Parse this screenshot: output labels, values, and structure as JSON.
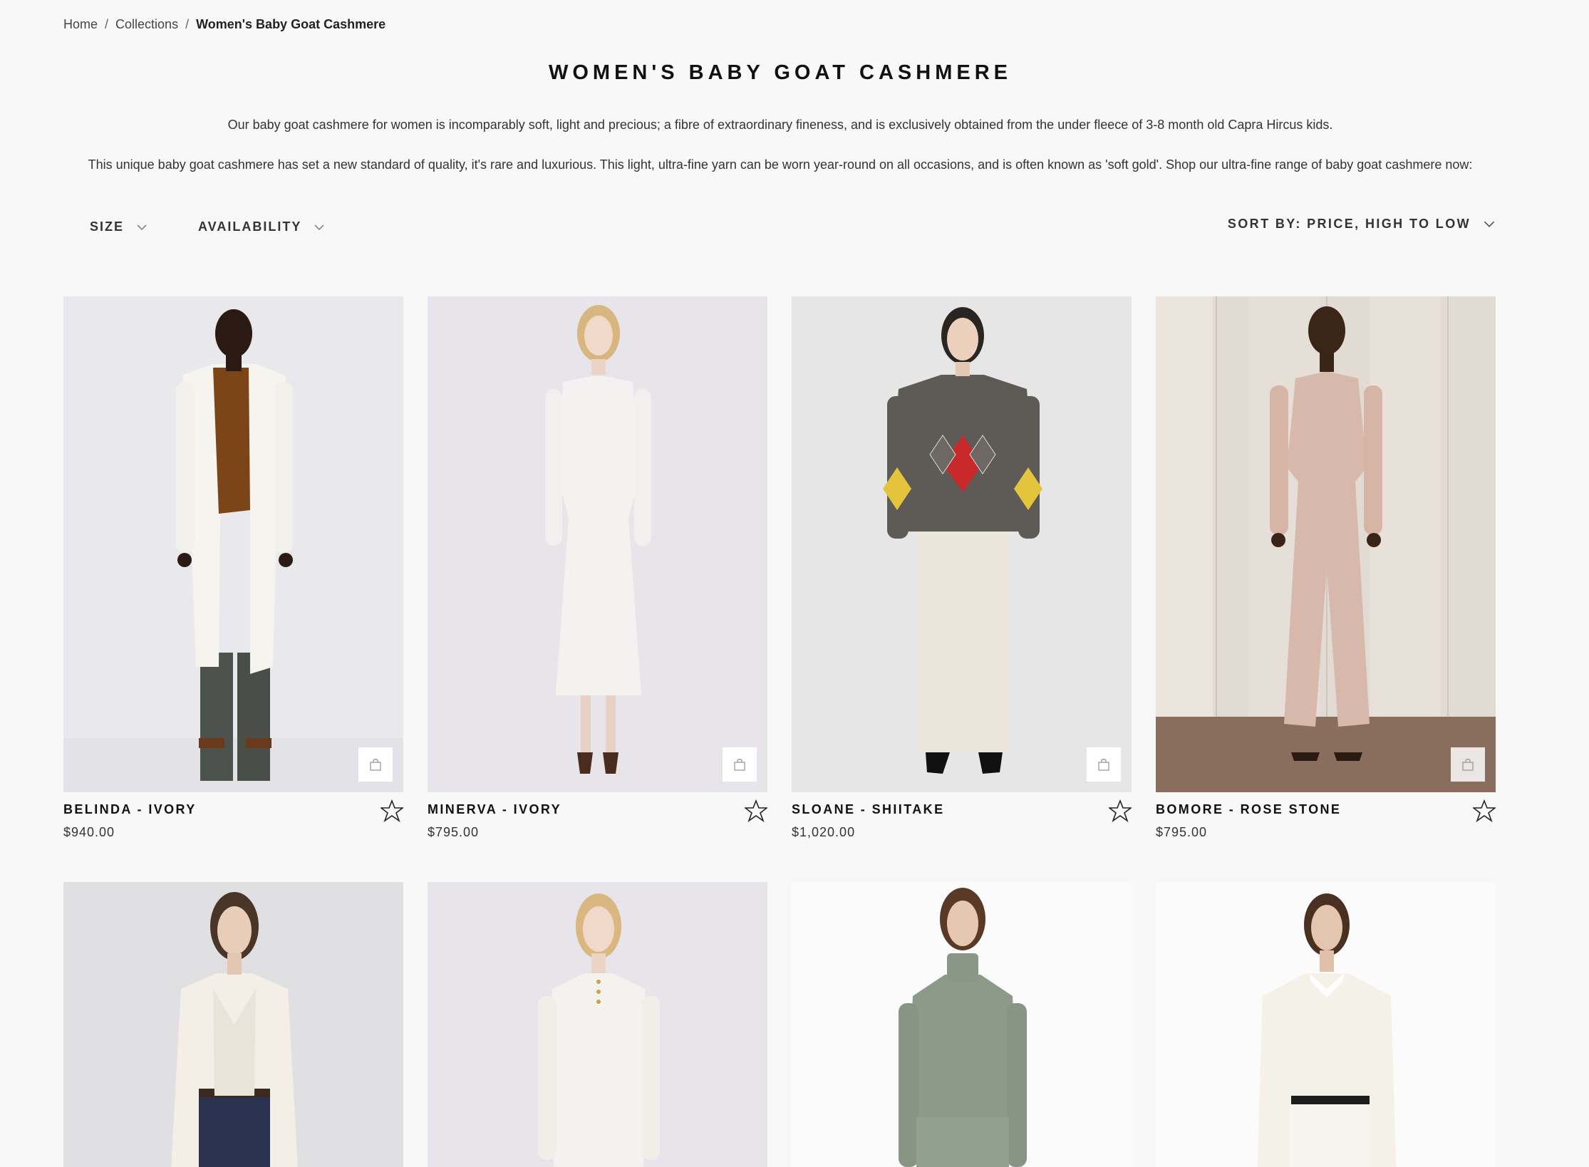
{
  "breadcrumb": {
    "home": "Home",
    "sep1": "/",
    "collections": "Collections",
    "sep2": "/",
    "current": "Women's Baby Goat Cashmere"
  },
  "title": "WOMEN'S BABY GOAT CASHMERE",
  "description": {
    "p1": "Our baby goat cashmere for women is incomparably soft, light and precious; a fibre of extraordinary fineness, and is exclusively obtained from the under fleece of 3-8 month old Capra Hircus kids.",
    "p2": "This unique baby goat cashmere has set a new standard of quality, it's rare and luxurious. This light, ultra-fine yarn can be worn year-round on all occasions, and is often known as 'soft gold'. Shop our ultra-fine range of baby goat cashmere now:"
  },
  "filters": {
    "size": "SIZE",
    "availability": "AVAILABILITY"
  },
  "sort": {
    "label": "SORT BY: PRICE, HIGH TO LOW"
  },
  "products": [
    {
      "name": "BELINDA - IVORY",
      "price": "$940.00"
    },
    {
      "name": "MINERVA - IVORY",
      "price": "$795.00"
    },
    {
      "name": "SLOANE - SHIITAKE",
      "price": "$1,020.00"
    },
    {
      "name": "BOMORE - ROSE STONE",
      "price": "$795.00"
    }
  ],
  "icons": {
    "wishlist": "star-icon",
    "quick_add": "shopping-bag-icon",
    "dropdown": "chevron-down-icon"
  },
  "colors": {
    "background": "#f8f8f8",
    "text": "#1c1c1c"
  }
}
